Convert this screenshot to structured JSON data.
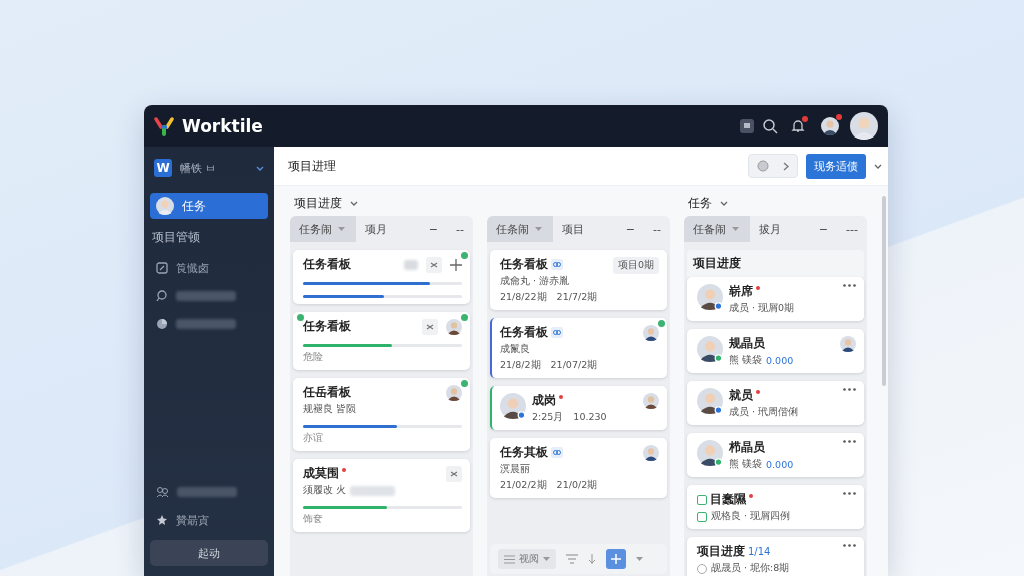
{
  "app": {
    "name": "Worktile",
    "bell_unread": true,
    "avatar_badge": true
  },
  "sidebar": {
    "workspace": {
      "letter": "W",
      "name": "幡铁 ㅂ"
    },
    "items": [
      {
        "kind": "current",
        "label": "任务",
        "selected": true
      },
      {
        "kind": "section",
        "label": "项目管顿"
      },
      {
        "kind": "edit",
        "label": "筤懴卤",
        "selected": false
      },
      {
        "kind": "chat",
        "selected": false
      },
      {
        "kind": "chart",
        "selected": false
      }
    ],
    "bottom_items": [
      {
        "kind": "people",
        "selected": false
      },
      {
        "kind": "star",
        "label": "贊朂寊",
        "selected": false
      }
    ],
    "button": "起动"
  },
  "header": {
    "title": "项目进理",
    "primary_button": "现务适债"
  },
  "columns": [
    {
      "group_title": "项目进度",
      "tabs": [
        {
          "label": "任务闹",
          "selected": true,
          "dropdown": true
        },
        {
          "label": "项月",
          "selected": false
        },
        {
          "label": "−",
          "selected": false
        },
        {
          "label": "--",
          "selected": false
        }
      ],
      "cards": [
        {
          "title": "任务看板",
          "dot": true,
          "actions": [
            {
              "kind": "blur"
            },
            {
              "kind": "tool"
            },
            {
              "kind": "plus"
            }
          ],
          "bars": [
            {
              "level": 0.8,
              "color": "#2f6fd0"
            },
            {
              "level": 0.51,
              "color": "#2f6fd0"
            }
          ]
        },
        {
          "title": "任务看板",
          "dot": true,
          "left_dot": true,
          "actions": [
            {
              "kind": "tool"
            },
            {
              "kind": "avatar"
            }
          ],
          "bars": [
            {
              "level": 0.56,
              "color": "#2fb36a"
            }
          ],
          "footer": "危险"
        },
        {
          "title": "任岳看板",
          "dot": true,
          "actions": [
            {
              "kind": "avatar"
            }
          ],
          "lines": [
            {
              "text": "规褪良 皆陨"
            }
          ],
          "bars": [
            {
              "level": 0.59,
              "color": "#2f6fd0"
            }
          ],
          "footer": "亦谊"
        },
        {
          "title": "成莫围",
          "flag": true,
          "actions": [
            {
              "kind": "tool"
            }
          ],
          "lines": [
            {
              "text": "须履改 火",
              "blur": true
            }
          ],
          "bars": [
            {
              "level": 0.53,
              "color": "#2fb36a"
            }
          ],
          "footer": "饰奁"
        }
      ]
    },
    {
      "tabs": [
        {
          "label": "任条闹",
          "selected": true,
          "dropdown": true
        },
        {
          "label": "项目",
          "selected": false
        },
        {
          "label": "−",
          "selected": false
        },
        {
          "label": "--",
          "selected": false
        }
      ],
      "cards": [
        {
          "title": "任务看板",
          "title_icon": true,
          "tag": "项目0期",
          "lines": [
            {
              "text": "成龠丸 · 游赤胤"
            },
            {
              "text": "21/8/22期　21/7/2期"
            }
          ]
        },
        {
          "title": "任务看板",
          "title_icon": true,
          "color": "#4a67d6",
          "dot": true,
          "actions": [
            {
              "kind": "avatar"
            }
          ],
          "lines": [
            {
              "text": "成鬣良"
            },
            {
              "text": "21/8/2期　21/07/2期"
            }
          ]
        },
        {
          "title": "成岗",
          "flag": true,
          "avatar": true,
          "color": "#2fb36a",
          "actions": [
            {
              "kind": "avatar"
            }
          ],
          "lines": [
            {
              "text": "2:25月　10.230"
            }
          ]
        },
        {
          "title": "任务其板",
          "title_icon": true,
          "actions": [
            {
              "kind": "avatar"
            }
          ],
          "lines": [
            {
              "text": "溟晨丽"
            },
            {
              "text": "21/02/2期　21/0/2期"
            }
          ]
        }
      ],
      "toolbar": {
        "view": "视阅"
      }
    },
    {
      "group_title": "任务",
      "tabs": [
        {
          "label": "任备闹",
          "selected": true,
          "dropdown": true
        },
        {
          "label": "拔月",
          "selected": false
        },
        {
          "label": "−",
          "selected": false
        },
        {
          "label": "---",
          "selected": false
        }
      ],
      "section": "项目进度",
      "cards": [
        {
          "title": "崭席",
          "flag": true,
          "avatar": true,
          "actions": [
            {
              "kind": "more"
            }
          ],
          "lines": [
            {
              "text": "成员 · 现屑0期"
            }
          ]
        },
        {
          "title": "规晶员",
          "avatar": true,
          "actions": [
            {
              "kind": "avatar"
            }
          ],
          "lines": [
            {
              "text": "熊 镁袋",
              "value": "0.000"
            }
          ]
        },
        {
          "title": "就员",
          "flag": true,
          "avatar": true,
          "actions": [
            {
              "kind": "more"
            }
          ],
          "lines": [
            {
              "text": "成员 · 玳周偕俐"
            }
          ]
        },
        {
          "title": "栉晶员",
          "avatar": true,
          "actions": [
            {
              "kind": "more"
            }
          ],
          "lines": [
            {
              "text": "熊 镁袋",
              "value": "0.000"
            }
          ]
        },
        {
          "title": "目蠢隰",
          "flag": true,
          "checked": false,
          "actions": [
            {
              "kind": "more"
            }
          ],
          "lines": [
            {
              "text": "观格良 · 现屑四例",
              "kind": "check",
              "checked": false
            }
          ]
        },
        {
          "title": "项目进度",
          "title_value": "1/14",
          "actions": [
            {
              "kind": "more"
            }
          ],
          "lines": [
            {
              "text": "觇晟员 · 坭你:8期",
              "kind": "radio",
              "selected": false
            }
          ]
        }
      ]
    }
  ]
}
